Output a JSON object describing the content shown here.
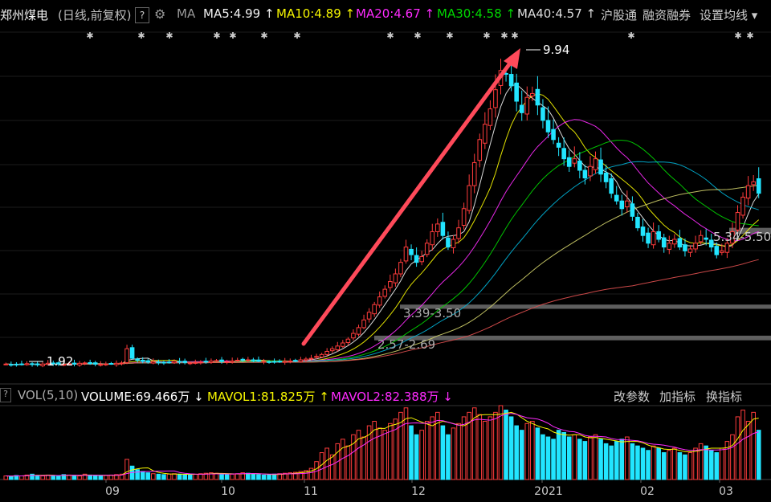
{
  "header": {
    "stock_name": "郑州煤电",
    "period": "(日线,前复权)",
    "question": "?",
    "ma_label": "MA",
    "ma5": "MA5:4.99 ↑",
    "ma10": "MA10:4.89 ↑",
    "ma20": "MA20:4.67 ↑",
    "ma30": "MA30:4.58 ↑",
    "ma40": "MA40:4.57 ↑",
    "hk_connect": "沪股通",
    "margin": "融资融券",
    "set_ma": "设置均线 ▾",
    "gear_icon": "gear-icon"
  },
  "volume_header": {
    "question": "?",
    "label": "VOL(5,10)",
    "volume": "VOLUME:69.466万 ↓",
    "mavol1": "MAVOL1:81.825万 ↑",
    "mavol2": "MAVOL2:82.388万 ↓",
    "btn_params": "改参数",
    "btn_add": "加指标",
    "btn_switch": "换指标"
  },
  "annotations": {
    "high": "9.94",
    "low": "1.92",
    "zone1": "5.34-5.50",
    "zone2": "3.39-3.50",
    "zone3": "2.57-2.69"
  },
  "colors": {
    "up": "#ff3c3c",
    "down": "#22e5ff",
    "ma5": "#f2f2f2",
    "ma10": "#f7f700",
    "ma20": "#ff2bff",
    "ma30": "#00d800",
    "ma40": "#00b4d8",
    "arrow": "#ff4a5a"
  },
  "chart_data": {
    "type": "candlestick",
    "title": "郑州煤电",
    "x_ticks": [
      "09",
      "10",
      "11",
      "12",
      "2021",
      "02",
      "03"
    ],
    "price_range": [
      1.6,
      10.6
    ],
    "key_levels": {
      "low": 1.92,
      "high": 9.94,
      "zones": [
        [
          5.34,
          5.5
        ],
        [
          3.39,
          3.5
        ],
        [
          2.57,
          2.69
        ]
      ]
    },
    "ma_latest": {
      "MA5": 4.99,
      "MA10": 4.89,
      "MA20": 4.67,
      "MA30": 4.58,
      "MA40": 4.57
    },
    "volume_latest_wan": {
      "VOLUME": 69.466,
      "MAVOL1": 81.825,
      "MAVOL2": 82.388
    },
    "close_series": [
      1.95,
      1.94,
      1.93,
      1.95,
      1.96,
      1.94,
      1.93,
      1.95,
      1.97,
      1.96,
      1.95,
      1.94,
      1.96,
      1.95,
      1.97,
      1.98,
      1.96,
      1.95,
      1.94,
      1.95,
      1.96,
      1.97,
      1.98,
      2.35,
      2.1,
      2.05,
      2.02,
      2.0,
      2.01,
      1.99,
      1.98,
      2.0,
      2.02,
      2.01,
      1.99,
      1.98,
      1.99,
      2.0,
      2.01,
      2.03,
      2.04,
      2.02,
      2.01,
      2.03,
      2.05,
      2.07,
      2.06,
      2.04,
      2.03,
      2.02,
      2.01,
      2.0,
      2.01,
      2.02,
      2.03,
      2.04,
      2.06,
      2.08,
      2.1,
      2.15,
      2.2,
      2.28,
      2.35,
      2.42,
      2.5,
      2.6,
      2.75,
      2.9,
      3.1,
      3.3,
      3.5,
      3.7,
      3.9,
      4.1,
      4.3,
      4.6,
      5.0,
      4.8,
      4.6,
      4.75,
      5.1,
      5.4,
      5.6,
      5.3,
      5.0,
      5.2,
      5.5,
      6.0,
      6.6,
      7.2,
      7.8,
      8.2,
      8.6,
      9.1,
      9.6,
      9.5,
      9.2,
      8.8,
      8.5,
      8.9,
      9.0,
      8.7,
      8.3,
      8.0,
      7.8,
      7.6,
      7.3,
      7.1,
      7.3,
      7.0,
      6.8,
      7.1,
      7.3,
      6.9,
      6.7,
      6.4,
      6.2,
      6.0,
      6.2,
      5.8,
      5.5,
      5.3,
      5.1,
      5.4,
      5.2,
      5.0,
      5.1,
      5.2,
      5.0,
      4.9,
      4.95,
      5.1,
      5.3,
      5.2,
      5.0,
      4.8,
      4.9,
      5.1,
      5.4,
      5.9,
      6.3,
      6.6,
      6.7,
      6.4
    ],
    "volume_series_wan": [
      8,
      7,
      9,
      8,
      10,
      12,
      9,
      8,
      10,
      9,
      8,
      11,
      10,
      9,
      8,
      12,
      10,
      9,
      8,
      9,
      10,
      11,
      12,
      45,
      30,
      22,
      18,
      15,
      13,
      12,
      11,
      12,
      13,
      12,
      10,
      11,
      12,
      13,
      14,
      15,
      14,
      12,
      11,
      12,
      13,
      15,
      14,
      12,
      11,
      10,
      11,
      12,
      13,
      14,
      15,
      16,
      18,
      20,
      25,
      40,
      60,
      70,
      55,
      80,
      90,
      75,
      100,
      110,
      95,
      120,
      130,
      115,
      110,
      125,
      135,
      150,
      160,
      120,
      100,
      110,
      130,
      140,
      150,
      120,
      100,
      115,
      125,
      140,
      150,
      160,
      145,
      130,
      140,
      150,
      165,
      155,
      140,
      120,
      110,
      125,
      130,
      115,
      100,
      95,
      90,
      110,
      105,
      95,
      100,
      90,
      85,
      95,
      100,
      90,
      80,
      75,
      85,
      90,
      95,
      80,
      75,
      70,
      65,
      75,
      70,
      60,
      65,
      70,
      60,
      55,
      60,
      70,
      80,
      75,
      65,
      60,
      70,
      85,
      100,
      140,
      155,
      130,
      150,
      110
    ]
  }
}
